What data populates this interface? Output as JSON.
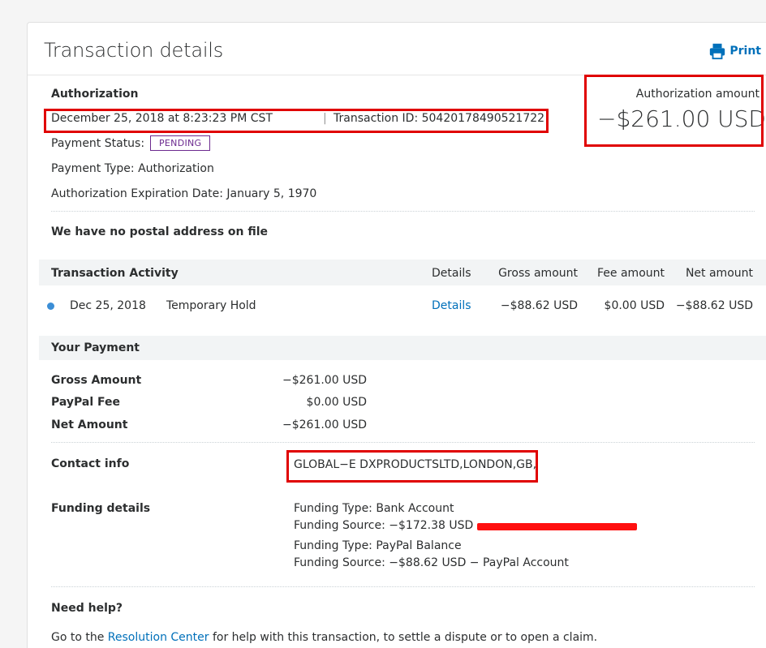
{
  "header": {
    "title": "Transaction details",
    "print_label": "Print"
  },
  "authorization": {
    "heading": "Authorization",
    "date_time": "December 25, 2018 at 8:23:23 PM CST",
    "separator": "|",
    "transaction_id": "Transaction ID: 50420178490521722",
    "payment_status_label": "Payment Status:",
    "payment_status_badge": "PENDING",
    "payment_type": "Payment Type: Authorization",
    "expiration": "Authorization Expiration Date: January 5, 1970",
    "amount_label": "Authorization amount",
    "amount_value": "−$261.00 USD"
  },
  "postal": {
    "notice": "We have no postal address on file"
  },
  "activity": {
    "heading": "Transaction Activity",
    "columns": {
      "details": "Details",
      "gross": "Gross amount",
      "fee": "Fee amount",
      "net": "Net amount"
    },
    "rows": [
      {
        "date": "Dec 25, 2018",
        "description": "Temporary Hold",
        "details_link": "Details",
        "gross": "−$88.62 USD",
        "fee": "$0.00 USD",
        "net": "−$88.62 USD"
      }
    ]
  },
  "payment": {
    "heading": "Your Payment",
    "gross_label": "Gross Amount",
    "gross_value": "−$261.00 USD",
    "fee_label": "PayPal Fee",
    "fee_value": "$0.00 USD",
    "net_label": "Net Amount",
    "net_value": "−$261.00 USD",
    "contact_label": "Contact info",
    "contact_value": "GLOBAL−E DXPRODUCTSLTD,LONDON,GB,",
    "funding_label": "Funding details",
    "funding": [
      "Funding Type: Bank Account",
      "Funding Source: −$172.38 USD −",
      "Funding Type: PayPal Balance",
      "Funding Source: −$88.62 USD − PayPal Account"
    ]
  },
  "help": {
    "heading": "Need help?",
    "text_before": "Go to the ",
    "link": "Resolution Center",
    "text_after": " for help with this transaction, to settle a dispute or to open a claim."
  },
  "colors": {
    "accent": "#0070ba",
    "badge": "#6c2a8f",
    "highlight": "#e00000"
  }
}
